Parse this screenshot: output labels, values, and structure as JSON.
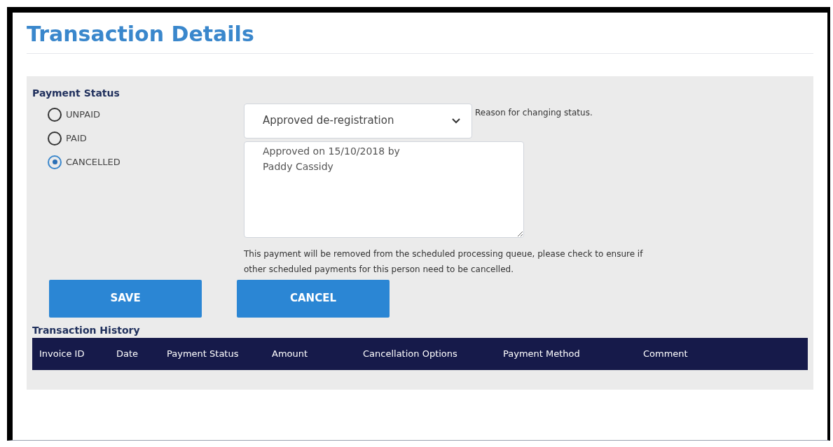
{
  "title": "Transaction Details",
  "payment_status": {
    "heading": "Payment Status",
    "options": [
      {
        "label": "UNPAID",
        "selected": false
      },
      {
        "label": "PAID",
        "selected": false
      },
      {
        "label": "CANCELLED",
        "selected": true
      }
    ]
  },
  "reason": {
    "value": "Approved de-registration",
    "hint": "Reason for changing status."
  },
  "comment": {
    "value": "Approved on 15/10/2018 by\nPaddy Cassidy"
  },
  "notice": "This payment will be removed from the scheduled processing queue, please check to ensure if other scheduled payments for this person need to be cancelled.",
  "buttons": [
    "SAVE",
    "CANCEL"
  ],
  "history": {
    "heading": "Transaction History",
    "columns": [
      "Invoice ID",
      "Date",
      "Payment Status",
      "Amount",
      "Cancellation Options",
      "Payment Method",
      "Comment"
    ]
  }
}
